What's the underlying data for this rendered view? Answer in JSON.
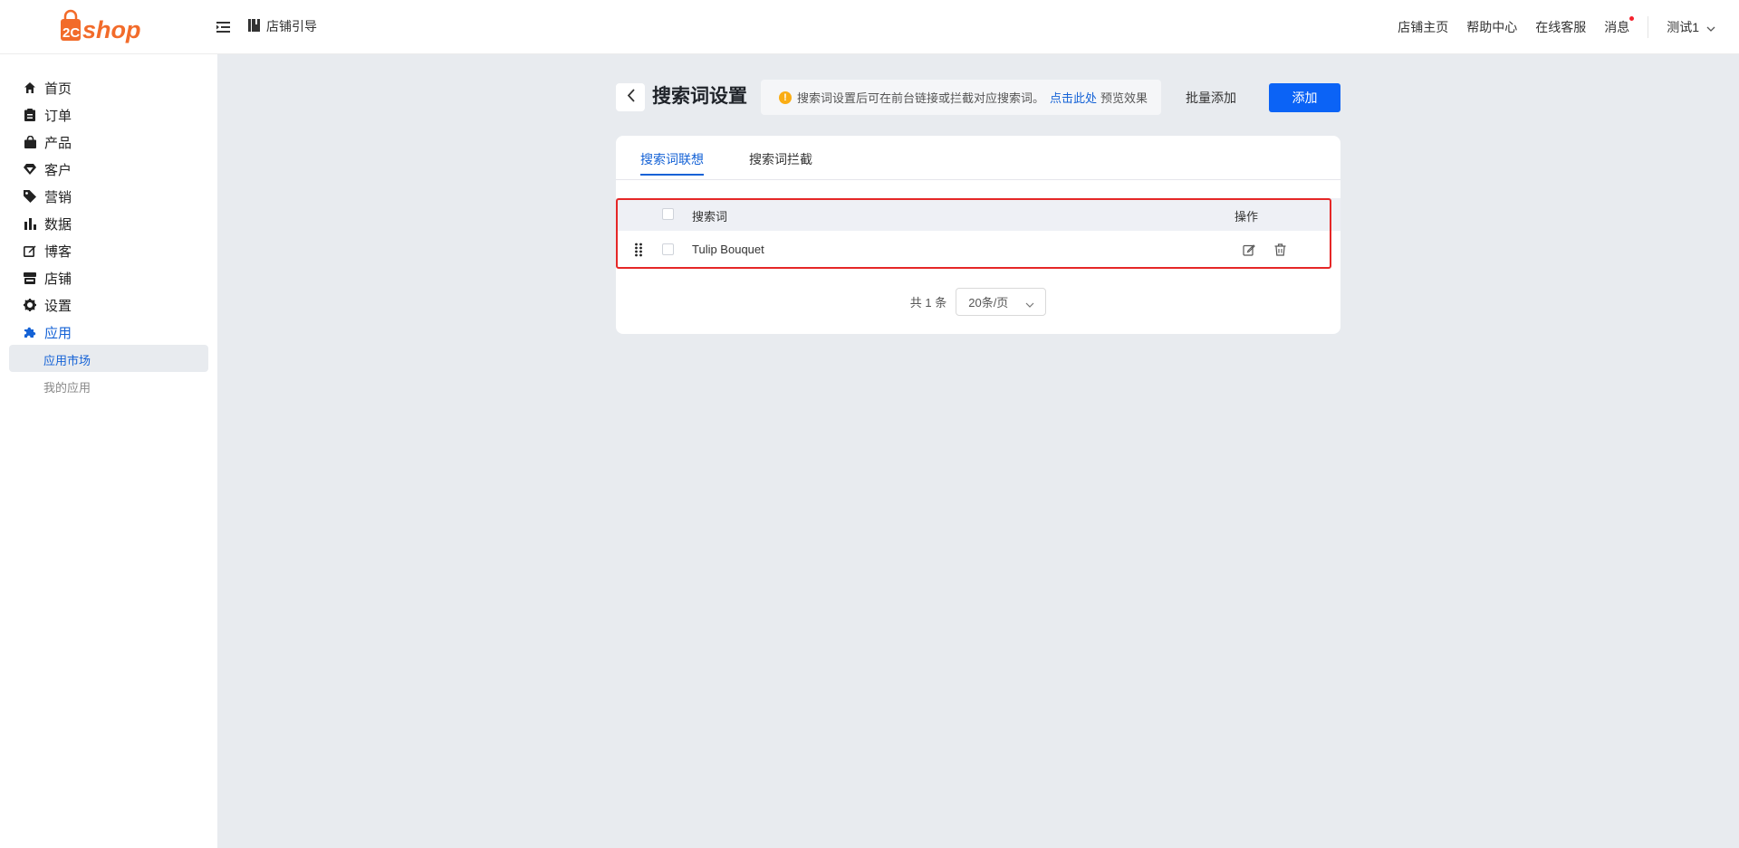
{
  "header": {
    "logo_text": "shop",
    "guide_label": "店铺引导",
    "nav": {
      "store_home": "店铺主页",
      "help_center": "帮助中心",
      "online_service": "在线客服",
      "messages": "消息"
    },
    "user_name": "测试1"
  },
  "sidebar": {
    "items": [
      {
        "label": "首页",
        "icon": "home-icon"
      },
      {
        "label": "订单",
        "icon": "clipboard-icon"
      },
      {
        "label": "产品",
        "icon": "bag-icon"
      },
      {
        "label": "客户",
        "icon": "gem-icon"
      },
      {
        "label": "营销",
        "icon": "tag-icon"
      },
      {
        "label": "数据",
        "icon": "bar-chart-icon"
      },
      {
        "label": "博客",
        "icon": "edit-icon"
      },
      {
        "label": "店铺",
        "icon": "store-icon"
      },
      {
        "label": "设置",
        "icon": "gear-icon"
      },
      {
        "label": "应用",
        "icon": "puzzle-icon"
      }
    ],
    "sub_items": [
      {
        "label": "应用市场"
      },
      {
        "label": "我的应用"
      }
    ]
  },
  "page": {
    "title": "搜索词设置",
    "notice": {
      "text": "搜索词设置后可在前台链接或拦截对应搜索词。",
      "link": "点击此处",
      "after": "预览效果"
    },
    "batch_add_label": "批量添加",
    "add_label": "添加"
  },
  "tabs": [
    {
      "label": "搜索词联想"
    },
    {
      "label": "搜索词拦截"
    }
  ],
  "table": {
    "columns": {
      "keyword": "搜索词",
      "actions": "操作"
    },
    "rows": [
      {
        "keyword": "Tulip Bouquet"
      }
    ]
  },
  "pagination": {
    "total": "共 1 条",
    "page_size": "20条/页"
  },
  "colors": {
    "brand": "#f26b2a",
    "primary": "#0b63f6",
    "link": "#1462d6",
    "highlight": "#e52727"
  }
}
